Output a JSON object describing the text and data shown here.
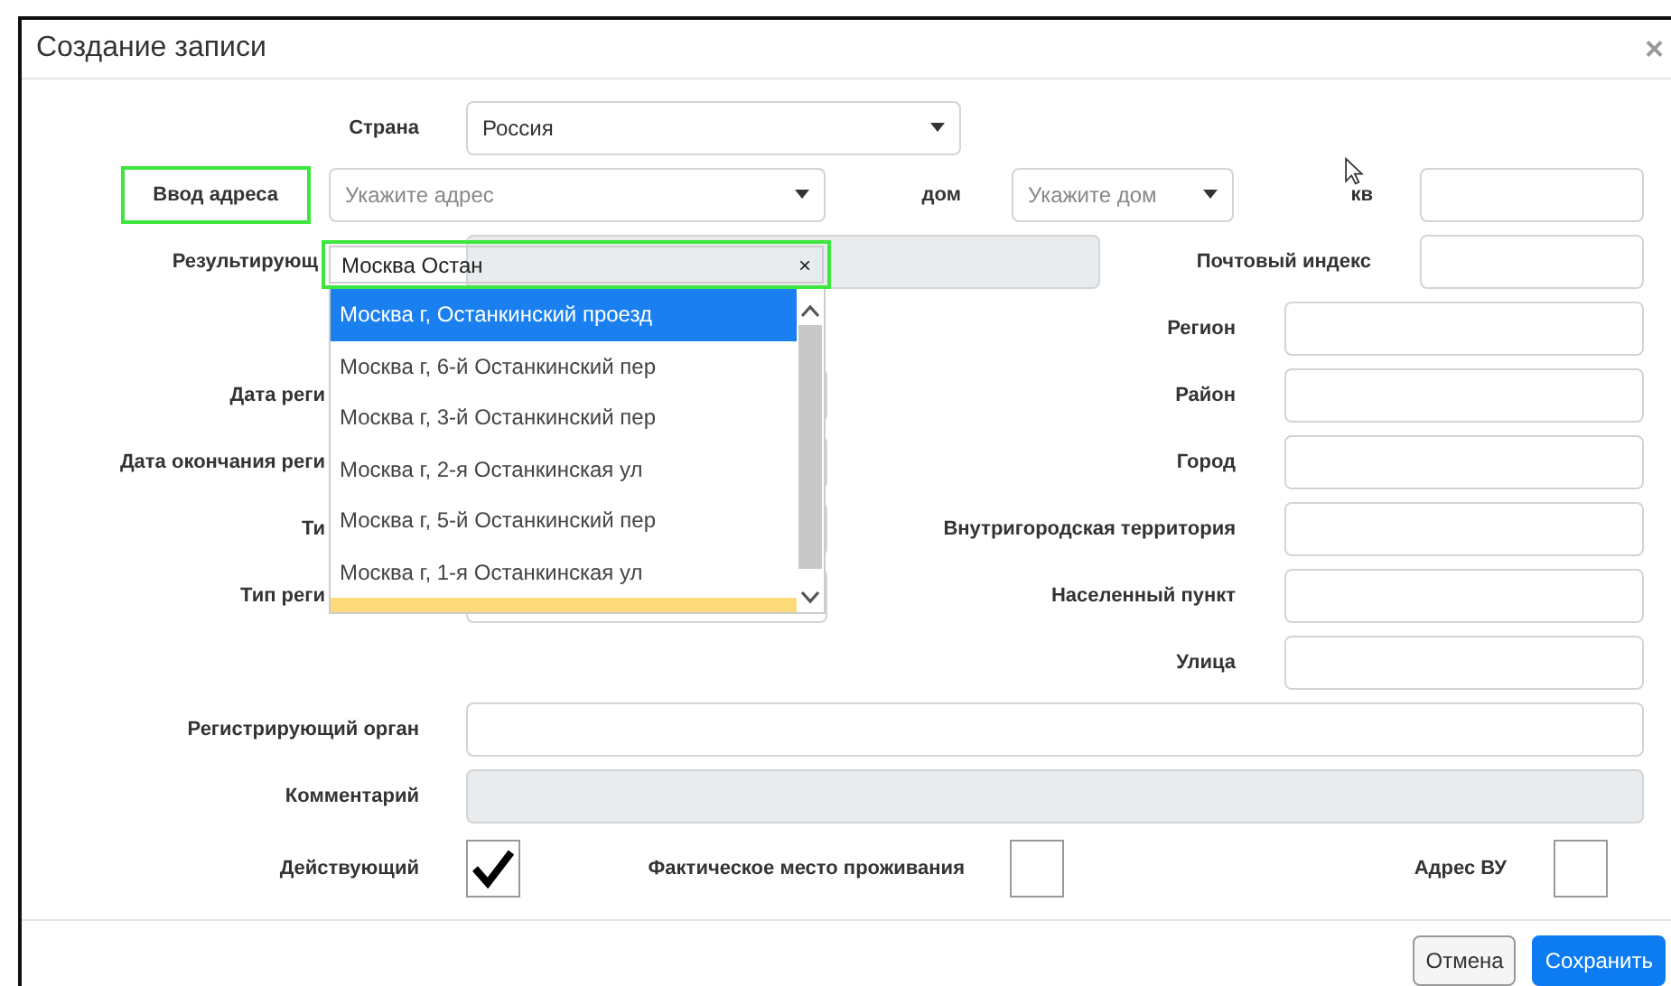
{
  "dialog": {
    "title": "Создание записи",
    "close": "×"
  },
  "country": {
    "label": "Страна",
    "value": "Россия"
  },
  "address": {
    "label": "Ввод адреса",
    "placeholder": "Укажите адрес",
    "house_label": "дом",
    "house_placeholder": "Укажите дом",
    "apt_label": "кв"
  },
  "result": {
    "label": "Результирующ",
    "disabled": true,
    "postal_label": "Почтовый индекс"
  },
  "rows": [
    {
      "left_label": null,
      "right_label": "Регион"
    },
    {
      "left_label": "Дата реги",
      "right_label": "Район"
    },
    {
      "left_label": "Дата окончания реги",
      "right_label": "Город"
    },
    {
      "left_label": "Ти",
      "right_label": "Внутригородская территория"
    },
    {
      "left_label": "Тип реги",
      "right_label": "Населенный пункт"
    },
    {
      "left_label": null,
      "right_label": "Улица"
    }
  ],
  "registrar": {
    "label": "Регистрирующий орган",
    "disabled": false
  },
  "comment": {
    "label": "Комментарий",
    "disabled": true
  },
  "checks": [
    {
      "label": "Действующий",
      "checked": true
    },
    {
      "label": "Фактическое место проживания",
      "checked": false
    },
    {
      "label": "Адрес ВУ",
      "checked": false
    }
  ],
  "buttons": [
    {
      "label": "Отмена",
      "kind": "default"
    },
    {
      "label": "Сохранить",
      "kind": "primary"
    }
  ],
  "autocomplete": {
    "query": "Москва Остан",
    "clear": "×",
    "options": [
      {
        "text": "Москва г, Останкинский проезд",
        "selected": true
      },
      {
        "text": "Москва г, 6-й Останкинский пер",
        "selected": false
      },
      {
        "text": "Москва г, 3-й Останкинский пер",
        "selected": false
      },
      {
        "text": "Москва г, 2-я Останкинская ул",
        "selected": false
      },
      {
        "text": "Москва г, 5-й Останкинский пер",
        "selected": false
      },
      {
        "text": "Москва г, 1-я Останкинская ул",
        "selected": false
      }
    ]
  }
}
